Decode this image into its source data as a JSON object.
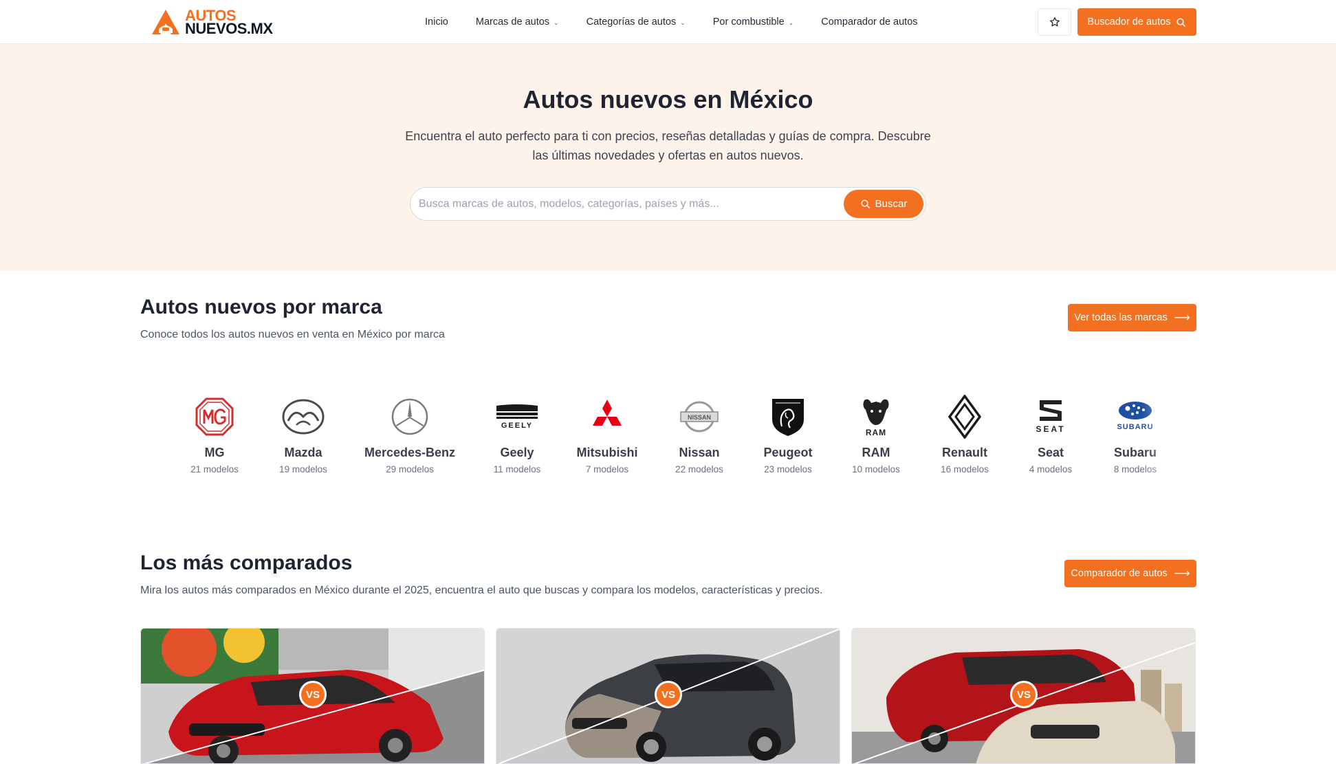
{
  "brand": {
    "line1": "AUTOS",
    "line2": "NUEVOS.MX",
    "accent": "#f37021"
  },
  "nav": {
    "items": [
      {
        "label": "Inicio",
        "dropdown": false
      },
      {
        "label": "Marcas de autos",
        "dropdown": true
      },
      {
        "label": "Categorías de autos",
        "dropdown": true
      },
      {
        "label": "Por combustible",
        "dropdown": true
      },
      {
        "label": "Comparador de autos",
        "dropdown": false
      }
    ],
    "favorites_icon": "star-icon",
    "search_button": "Buscador de autos"
  },
  "hero": {
    "title": "Autos nuevos en México",
    "subtitle": "Encuentra el auto perfecto para ti con precios, reseñas detalladas y guías de compra. Descubre las últimas novedades y ofertas en autos nuevos.",
    "search_placeholder": "Busca marcas de autos, modelos, categorías, países y más...",
    "search_button": "Buscar"
  },
  "brands_section": {
    "title": "Autos nuevos por marca",
    "subtitle": "Conoce todos los autos nuevos en venta en México por marca",
    "button": "Ver todas las marcas",
    "items": [
      {
        "name": "MG",
        "count": "21 modelos"
      },
      {
        "name": "Mazda",
        "count": "19 modelos"
      },
      {
        "name": "Mercedes-Benz",
        "count": "29 modelos"
      },
      {
        "name": "Geely",
        "count": "11 modelos"
      },
      {
        "name": "Mitsubishi",
        "count": "7 modelos"
      },
      {
        "name": "Nissan",
        "count": "22 modelos"
      },
      {
        "name": "Peugeot",
        "count": "23 modelos"
      },
      {
        "name": "RAM",
        "count": "10 modelos"
      },
      {
        "name": "Renault",
        "count": "16 modelos"
      },
      {
        "name": "Seat",
        "count": "4 modelos"
      },
      {
        "name": "Subaru",
        "count": "8 modelos"
      }
    ]
  },
  "compared_section": {
    "title": "Los más comparados",
    "subtitle": "Mira los autos más comparados en México durante el 2025, encuentra el auto que buscas y compara los modelos, características y precios.",
    "button": "Comparador de autos",
    "vs_label": "VS"
  }
}
